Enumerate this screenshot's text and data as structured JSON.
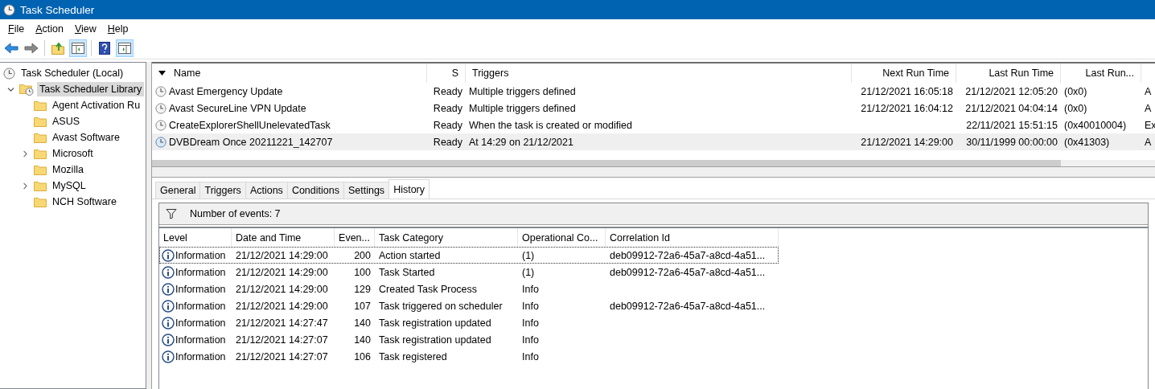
{
  "window": {
    "title": "Task Scheduler"
  },
  "menu": [
    "File",
    "Action",
    "View",
    "Help"
  ],
  "toolbar": [
    {
      "kind": "back",
      "pressed": false
    },
    {
      "kind": "forward",
      "pressed": false
    },
    {
      "kind": "separator"
    },
    {
      "kind": "up",
      "pressed": false
    },
    {
      "kind": "tree",
      "pressed": true
    },
    {
      "kind": "separator"
    },
    {
      "kind": "help",
      "pressed": false
    },
    {
      "kind": "pane",
      "pressed": true
    }
  ],
  "tree": [
    {
      "label": "Task Scheduler (Local)",
      "kind": "clock",
      "selected": false,
      "children": [
        {
          "label": "Task Scheduler Library",
          "kind": "library",
          "expanded": true,
          "selected": true,
          "children": [
            {
              "label": "Agent Activation Ru",
              "kind": "folder",
              "selected": false
            },
            {
              "label": "ASUS",
              "kind": "folder",
              "selected": false
            },
            {
              "label": "Avast Software",
              "kind": "folder",
              "selected": false
            },
            {
              "label": "Microsoft",
              "kind": "folder",
              "expanded": false,
              "selected": false
            },
            {
              "label": "Mozilla",
              "kind": "folder",
              "selected": false
            },
            {
              "label": "MySQL",
              "kind": "folder",
              "expanded": false,
              "selected": false
            },
            {
              "label": "NCH Software",
              "kind": "folder",
              "selected": false
            }
          ]
        }
      ]
    }
  ],
  "tasks": {
    "columns": [
      {
        "label": "Name",
        "sorted": true
      },
      {
        "label": "S",
        "sorted": false
      },
      {
        "label": "Triggers",
        "sorted": false
      },
      {
        "label": "Next Run Time",
        "sorted": false
      },
      {
        "label": "Last Run Time",
        "sorted": false
      },
      {
        "label": "Last Run...",
        "sorted": false
      }
    ],
    "rows": [
      {
        "selected": false,
        "cells": [
          "Avast Emergency Update",
          "Ready",
          "Multiple triggers defined",
          "21/12/2021 16:05:18",
          "21/12/2021 12:05:20",
          "(0x0)",
          "A"
        ]
      },
      {
        "selected": false,
        "cells": [
          "Avast SecureLine VPN Update",
          "Ready",
          "Multiple triggers defined",
          "21/12/2021 16:04:12",
          "21/12/2021 04:04:14",
          "(0x0)",
          "A"
        ]
      },
      {
        "selected": false,
        "cells": [
          "CreateExplorerShellUnelevatedTask",
          "Ready",
          "When the task is created or modified",
          "",
          "22/11/2021 15:51:15",
          "(0x40010004)",
          "Ex"
        ]
      },
      {
        "selected": true,
        "cells": [
          "DVBDream Once 20211221_142707",
          "Ready",
          "At 14:29 on 21/12/2021",
          "21/12/2021 14:29:00",
          "30/11/1999 00:00:00",
          "(0x41303)",
          "A"
        ]
      }
    ]
  },
  "tabs": [
    {
      "label": "General",
      "selected": false
    },
    {
      "label": "Triggers",
      "selected": false
    },
    {
      "label": "Actions",
      "selected": false
    },
    {
      "label": "Conditions",
      "selected": false
    },
    {
      "label": "Settings",
      "selected": false
    },
    {
      "label": "History",
      "selected": true
    }
  ],
  "history": {
    "count_text": "Number of events: 7",
    "columns": [
      "Level",
      "Date and Time",
      "Even...",
      "Task Category",
      "Operational Co...",
      "Correlation Id"
    ],
    "rows": [
      {
        "selected": true,
        "level": "Information",
        "date": "21/12/2021 14:29:00",
        "event": "200",
        "category": "Action started",
        "opcode": "(1)",
        "correlation": "deb09912-72a6-45a7-a8cd-4a51..."
      },
      {
        "selected": false,
        "level": "Information",
        "date": "21/12/2021 14:29:00",
        "event": "100",
        "category": "Task Started",
        "opcode": "(1)",
        "correlation": "deb09912-72a6-45a7-a8cd-4a51..."
      },
      {
        "selected": false,
        "level": "Information",
        "date": "21/12/2021 14:29:00",
        "event": "129",
        "category": "Created Task Process",
        "opcode": "Info"
      },
      {
        "selected": false,
        "level": "Information",
        "date": "21/12/2021 14:29:00",
        "event": "107",
        "category": "Task triggered on scheduler",
        "opcode": "Info",
        "correlation": "deb09912-72a6-45a7-a8cd-4a51..."
      },
      {
        "selected": false,
        "level": "Information",
        "date": "21/12/2021 14:27:47",
        "event": "140",
        "category": "Task registration updated",
        "opcode": "Info"
      },
      {
        "selected": false,
        "level": "Information",
        "date": "21/12/2021 14:27:07",
        "event": "140",
        "category": "Task registration updated",
        "opcode": "Info"
      },
      {
        "selected": false,
        "level": "Information",
        "date": "21/12/2021 14:27:07",
        "event": "106",
        "category": "Task registered",
        "opcode": "Info"
      }
    ]
  }
}
